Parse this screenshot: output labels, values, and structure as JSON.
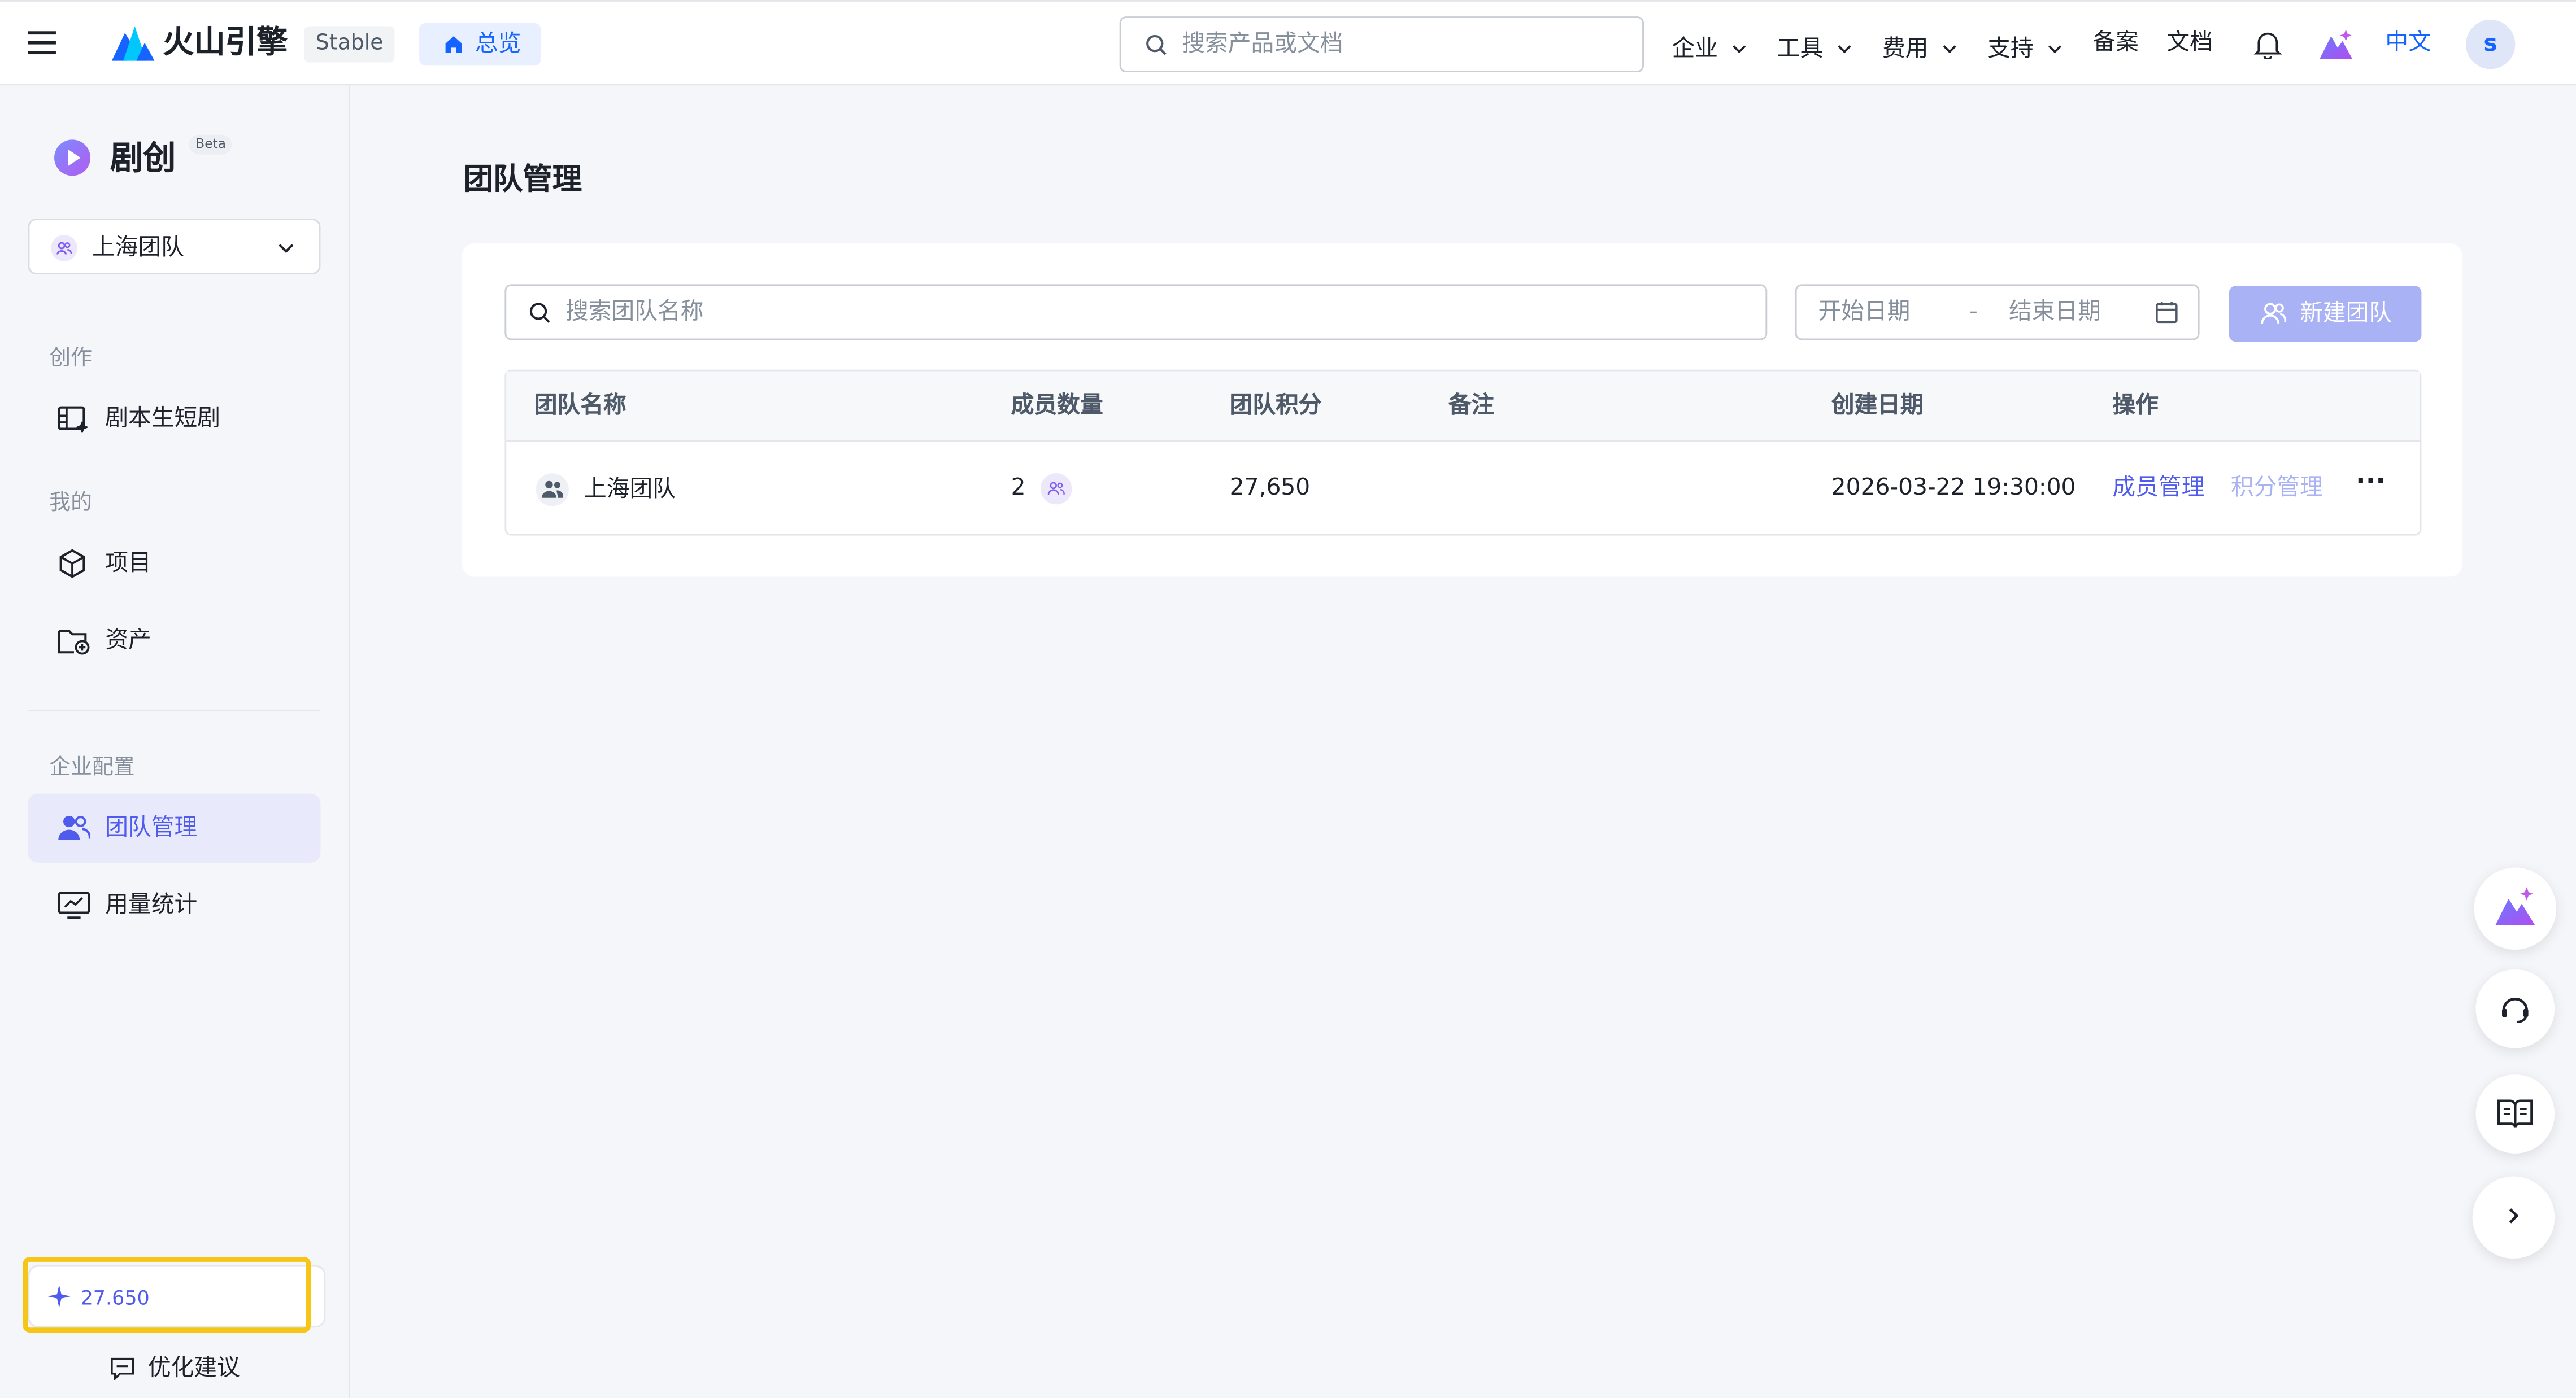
{
  "header": {
    "brand": "火山引擎",
    "env_badge": "Stable",
    "overview": "总览",
    "search_placeholder": "搜索产品或文档",
    "nav": [
      "企业",
      "工具",
      "费用",
      "支持",
      "备案",
      "文档"
    ],
    "language": "中文",
    "avatar_letter": "s"
  },
  "sidebar": {
    "app_name": "剧创",
    "beta_badge": "Beta",
    "team_select": "上海团队",
    "section_create": "创作",
    "item_script": "剧本生短剧",
    "section_mine": "我的",
    "item_projects": "项目",
    "item_assets": "资产",
    "section_enterprise": "企业配置",
    "item_team": "团队管理",
    "item_usage": "用量统计",
    "credits": "27.650",
    "feedback": "优化建议"
  },
  "main": {
    "page_title": "团队管理",
    "search_placeholder": "搜索团队名称",
    "start_date": "开始日期",
    "date_sep": "-",
    "end_date": "结束日期",
    "new_team_button": "新建团队",
    "columns": [
      "团队名称",
      "成员数量",
      "团队积分",
      "备注",
      "创建日期",
      "操作"
    ],
    "rows": [
      {
        "name": "上海团队",
        "members": "2",
        "points": "27,650",
        "note": "",
        "created": "2026-03-22 19:30:00",
        "action_members": "成员管理",
        "action_points": "积分管理",
        "more": "···"
      }
    ]
  },
  "colors": {
    "accent": "#4e5bec",
    "active_bg": "#e8e9fb",
    "highlight_box": "#f5c518",
    "disabled_button": "#a9b2f4"
  }
}
